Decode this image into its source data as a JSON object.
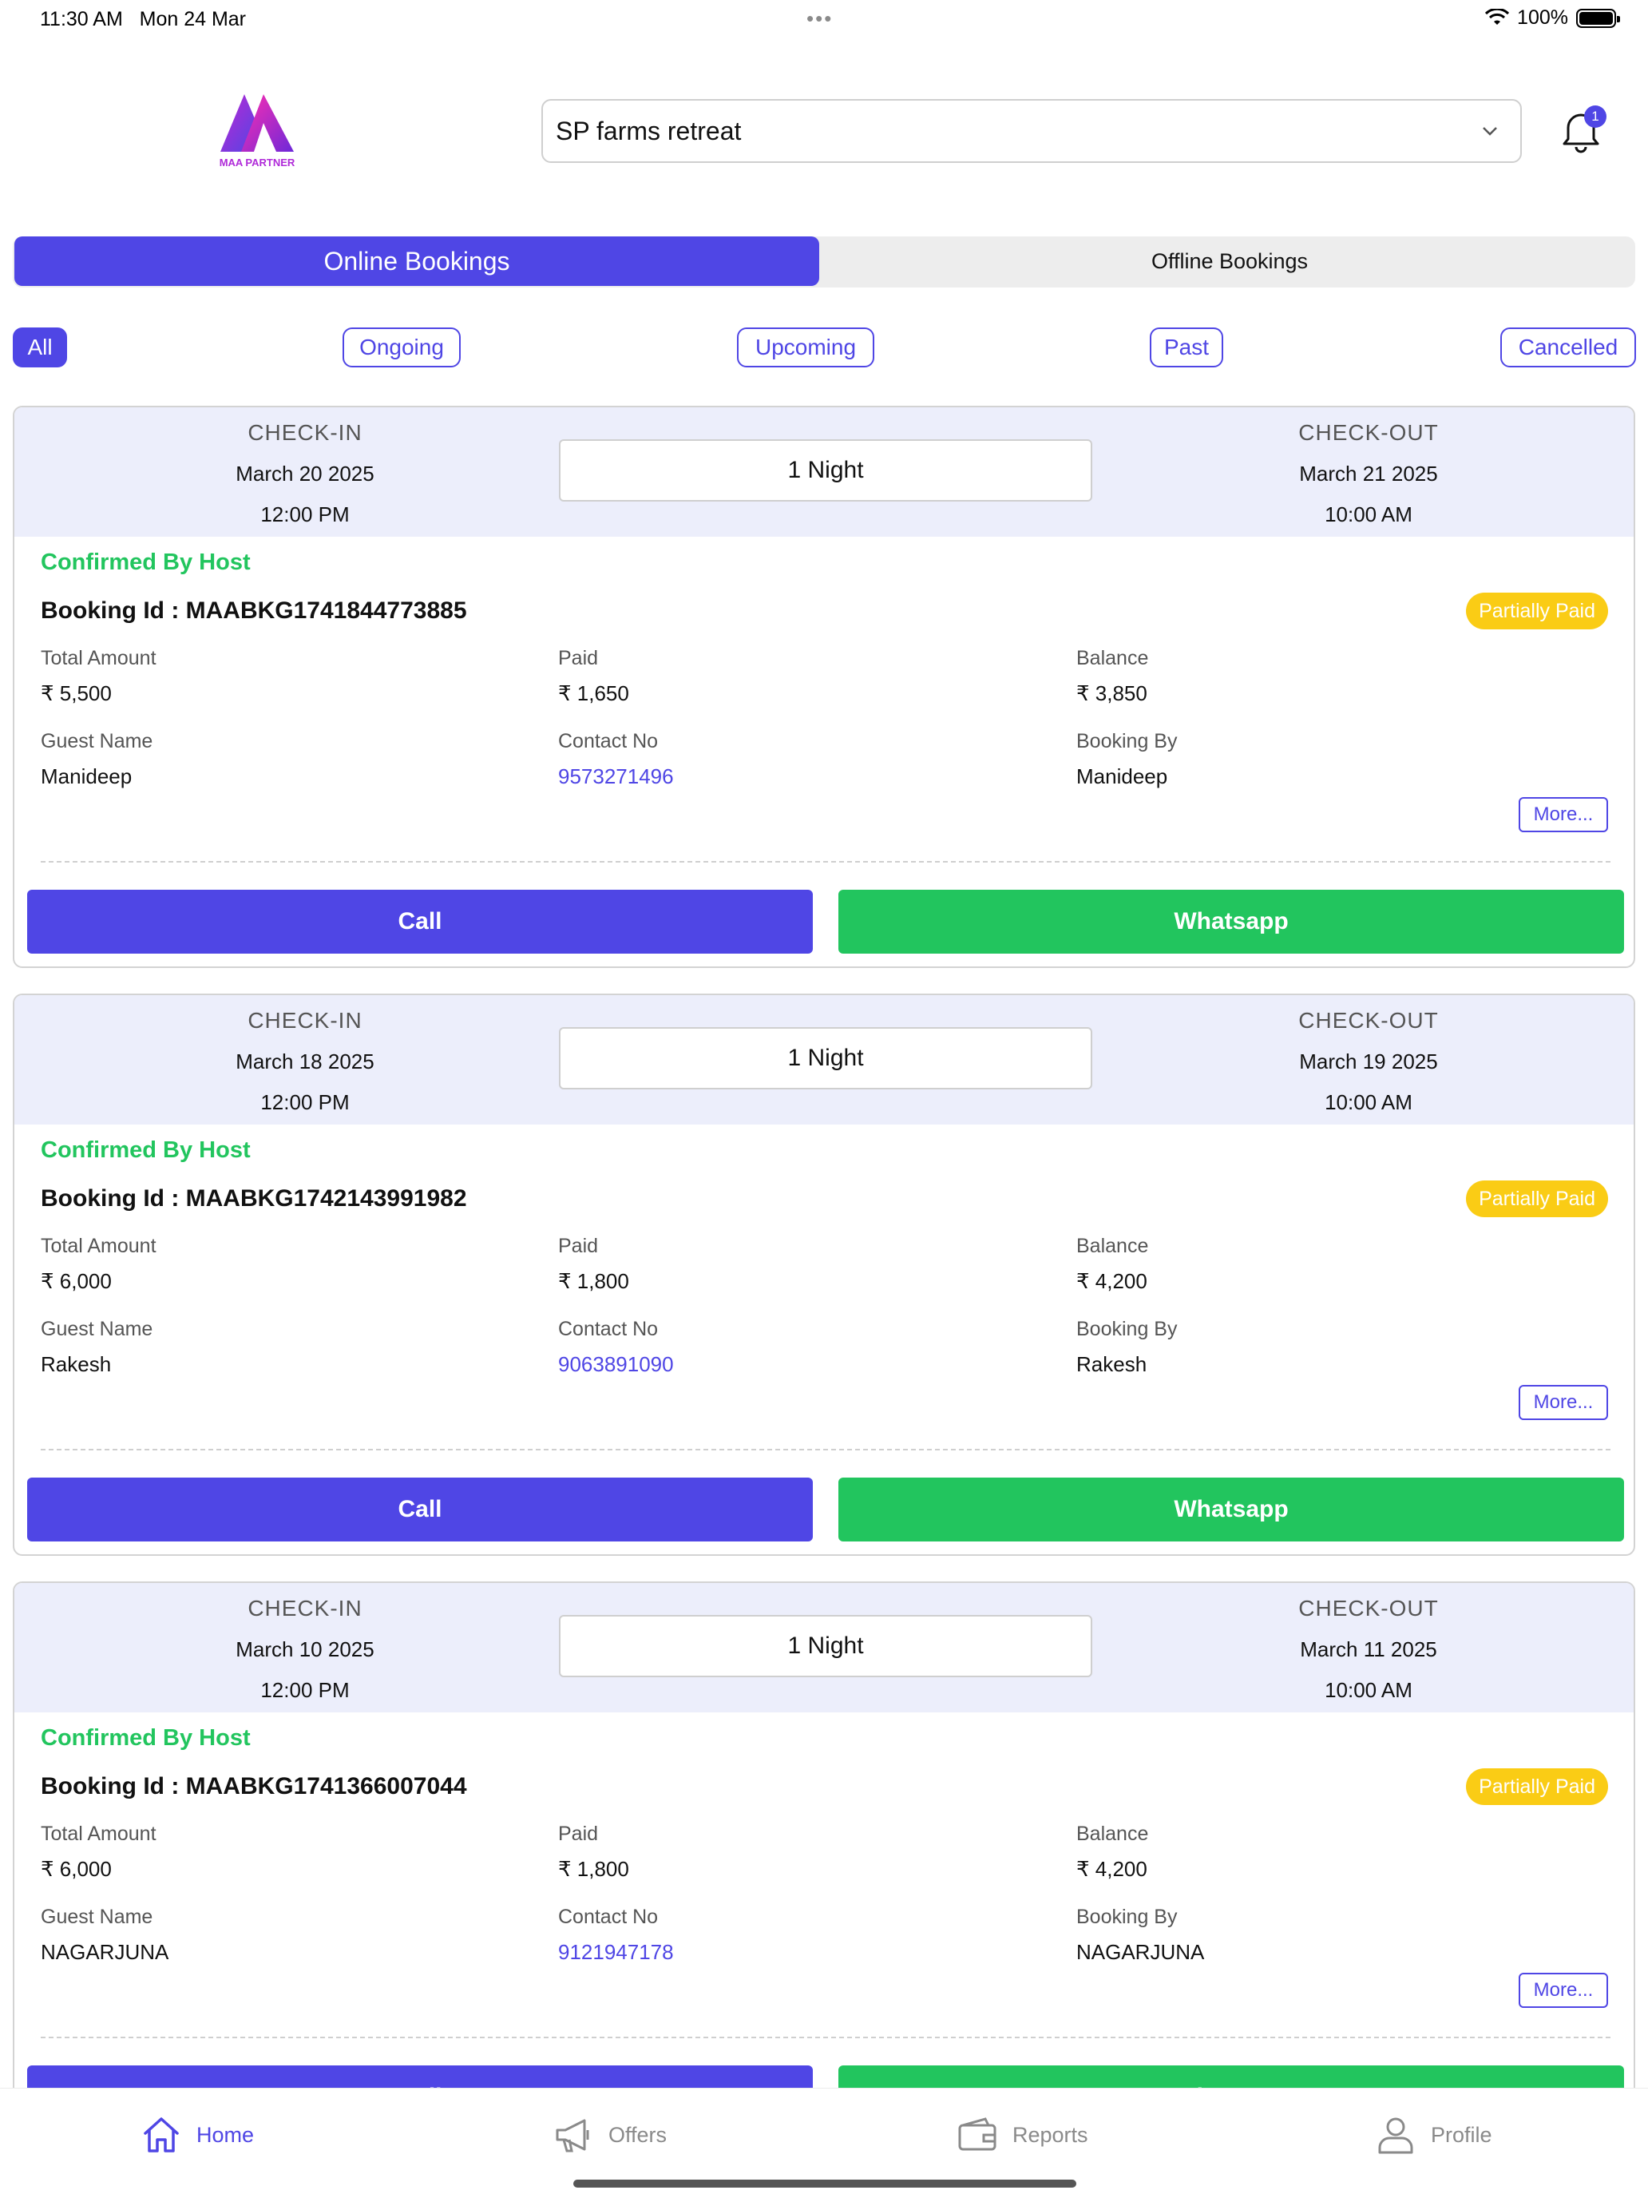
{
  "status_bar": {
    "time": "11:30 AM",
    "date": "Mon 24 Mar",
    "battery": "100%"
  },
  "header": {
    "logo_text": "MAA PARTNER",
    "property": "SP farms retreat",
    "notification_count": "1"
  },
  "tabs": {
    "online": "Online Bookings",
    "offline": "Offline Bookings",
    "selected": "online"
  },
  "filters": {
    "all": "All",
    "ongoing": "Ongoing",
    "upcoming": "Upcoming",
    "past": "Past",
    "cancelled": "Cancelled",
    "selected": "all"
  },
  "labels": {
    "check_in": "CHECK-IN",
    "check_out": "CHECK-OUT",
    "total_amount": "Total Amount",
    "paid": "Paid",
    "balance": "Balance",
    "guest_name": "Guest Name",
    "contact_no": "Contact No",
    "booking_by": "Booking By",
    "more": "More...",
    "call": "Call",
    "whatsapp": "Whatsapp"
  },
  "bookings": [
    {
      "checkin_date": "March 20 2025",
      "checkin_time": "12:00 PM",
      "checkout_date": "March 21 2025",
      "checkout_time": "10:00 AM",
      "nights": "1 Night",
      "status": "Confirmed By Host",
      "booking_id": "Booking Id : MAABKG1741844773885",
      "payment_status": "Partially Paid",
      "total": "₹ 5,500",
      "paid": "₹ 1,650",
      "balance": "₹ 3,850",
      "guest": "Manideep",
      "contact": "9573271496",
      "booked_by": "Manideep"
    },
    {
      "checkin_date": "March 18 2025",
      "checkin_time": "12:00 PM",
      "checkout_date": "March 19 2025",
      "checkout_time": "10:00 AM",
      "nights": "1 Night",
      "status": "Confirmed By Host",
      "booking_id": "Booking Id : MAABKG1742143991982",
      "payment_status": "Partially Paid",
      "total": "₹ 6,000",
      "paid": "₹ 1,800",
      "balance": "₹ 4,200",
      "guest": "Rakesh",
      "contact": "9063891090",
      "booked_by": "Rakesh"
    },
    {
      "checkin_date": "March 10 2025",
      "checkin_time": "12:00 PM",
      "checkout_date": "March 11 2025",
      "checkout_time": "10:00 AM",
      "nights": "1 Night",
      "status": "Confirmed By Host",
      "booking_id": "Booking Id : MAABKG1741366007044",
      "payment_status": "Partially Paid",
      "total": "₹ 6,000",
      "paid": "₹ 1,800",
      "balance": "₹ 4,200",
      "guest": "NAGARJUNA",
      "contact": "9121947178",
      "booked_by": "NAGARJUNA"
    }
  ],
  "bottom_nav": [
    {
      "label": "Home",
      "icon": "home-icon",
      "active": true
    },
    {
      "label": "Offers",
      "icon": "megaphone-icon",
      "active": false
    },
    {
      "label": "Reports",
      "icon": "wallet-icon",
      "active": false
    },
    {
      "label": "Profile",
      "icon": "user-icon",
      "active": false
    }
  ],
  "colors": {
    "primary": "#4f46e5",
    "success": "#22c55e",
    "warning": "#facc15",
    "card_header": "#eceefb"
  }
}
